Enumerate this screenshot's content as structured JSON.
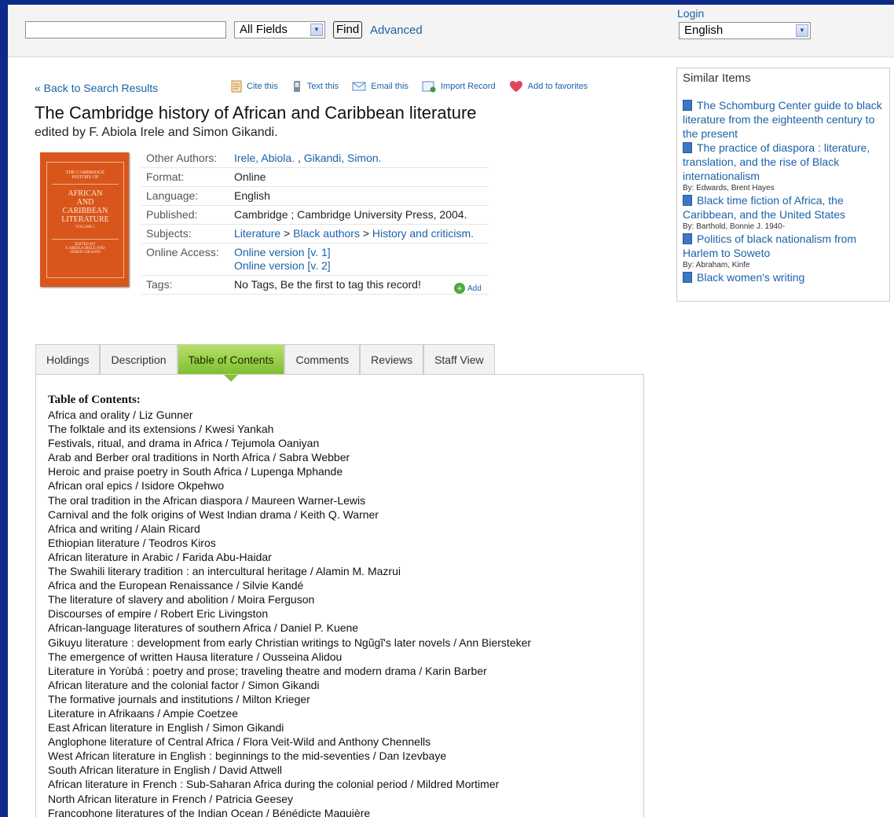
{
  "search": {
    "placeholder": "",
    "field_select": "All Fields",
    "find_label": "Find",
    "advanced_label": "Advanced"
  },
  "header": {
    "login_label": "Login",
    "language_select": "English"
  },
  "record": {
    "back_label": "« Back to Search Results",
    "toolbar": {
      "cite": "Cite this",
      "text": "Text this",
      "email": "Email this",
      "import": "Import Record",
      "favorite": "Add to favorites"
    },
    "title": "The Cambridge history of African and Caribbean literature",
    "subtitle": "edited by F. Abiola Irele and Simon Gikandi.",
    "cover": {
      "line1": "THE CAMBRIDGE",
      "line2": "HISTORY OF",
      "line3": "AFRICAN",
      "line4": "AND",
      "line5": "CARIBBEAN",
      "line6": "LITERATURE",
      "line7": "VOLUME 1",
      "line8": "EDITED BY",
      "line9": "F. ABIOLA IRELE AND",
      "line10": "SIMON GIKANDI"
    },
    "labels": {
      "other_authors": "Other Authors:",
      "format": "Format:",
      "language": "Language:",
      "published": "Published:",
      "subjects": "Subjects:",
      "online_access": "Online Access:",
      "tags": "Tags:"
    },
    "other_authors": [
      "Irele, Abiola.",
      "Gikandi, Simon."
    ],
    "format": "Online",
    "language": "English",
    "published": "Cambridge ; Cambridge University Press, 2004.",
    "subjects": [
      "Literature",
      "Black authors",
      "History and criticism."
    ],
    "online_access": [
      "Online version [v. 1]",
      "Online version [v. 2]"
    ],
    "tags_text": "No Tags, Be the first to tag this record!",
    "add_tag_label": "Add"
  },
  "tabs": [
    "Holdings",
    "Description",
    "Table of Contents",
    "Comments",
    "Reviews",
    "Staff View"
  ],
  "active_tab": "Table of Contents",
  "toc": {
    "heading": "Table of Contents:",
    "items": [
      "Africa and orality / Liz Gunner",
      "The folktale and its extensions / Kwesi Yankah",
      "Festivals, ritual, and drama in Africa / Tejumola Oaniyan",
      "Arab and Berber oral traditions in North Africa / Sabra Webber",
      "Heroic and praise poetry in South Africa / Lupenga Mphande",
      "African oral epics / Isidore Okpehwo",
      "The oral tradition in the African diaspora / Maureen Warner-Lewis",
      "Carnival and the folk origins of West Indian drama / Keith Q. Warner",
      "Africa and writing / Alain Ricard",
      "Ethiopian literature / Teodros Kiros",
      "African literature in Arabic / Farida Abu-Haidar",
      "The Swahili literary tradition : an intercultural heritage / Alamin M. Mazrui",
      "Africa and the European Renaissance / Silvie Kandé",
      "The literature of slavery and abolition / Moira Ferguson",
      "Discourses of empire / Robert Eric Livingston",
      "African-language literatures of southern Africa / Daniel P. Kuene",
      "Gikuyu literature : development from early Christian writings to Ngũgĩ's later novels / Ann Biersteker",
      "The emergence of written Hausa literature / Ousseina Alidou",
      "Literature in Yorùbá : poetry and prose; traveling theatre and modern drama / Karin Barber",
      "African literature and the colonial factor / Simon Gikandi",
      "The formative journals and institutions / Milton Krieger",
      "Literature in Afrikaans / Ampie Coetzee",
      "East African literature in English / Simon Gikandi",
      "Anglophone literature of Central Africa / Flora Veit-Wild and Anthony Chennells",
      "West African literature in English : beginnings to the mid-seventies / Dan Izevbaye",
      "South African literature in English / David Attwell",
      "African literature in French : Sub-Saharan Africa during the colonial period / Mildred Mortimer",
      "North African literature in French / Patricia Geesey",
      "Francophone literatures of the Indian Ocean / Bénédicte Maguière"
    ]
  },
  "similar": {
    "heading": "Similar Items",
    "items": [
      {
        "title": "The Schomburg Center guide to black literature from the eighteenth century to the present",
        "by": ""
      },
      {
        "title": "The practice of diaspora : literature, translation, and the rise of Black internationalism",
        "by": "By: Edwards, Brent Hayes"
      },
      {
        "title": "Black time fiction of Africa, the Caribbean, and the United States",
        "by": "By: Barthold, Bonnie J. 1940-"
      },
      {
        "title": "Politics of black nationalism from Harlem to Soweto",
        "by": "By: Abraham, Kinfe"
      },
      {
        "title": "Black women's writing",
        "by": ""
      }
    ]
  },
  "colors": {
    "link": "#1a62a8",
    "active_tab": "#84c233",
    "page_border": "#0d2a8a"
  }
}
